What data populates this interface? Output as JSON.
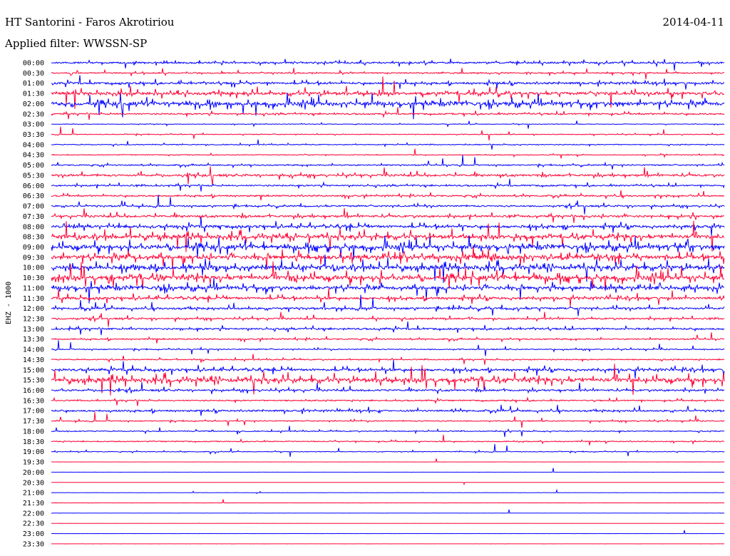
{
  "header": {
    "station": "HT Santorini - Faros Akrotiriou",
    "date": "2014-04-11",
    "filter": "Applied filter: WWSSN-SP"
  },
  "chart_data": {
    "type": "line",
    "ylabel": "EHZ - 1000",
    "colors": {
      "blue": "#0000ff",
      "red": "#ff0033"
    },
    "traces": [
      {
        "label": "00:00",
        "color": "blue",
        "activity": 0.35
      },
      {
        "label": "00:30",
        "color": "red",
        "activity": 0.25
      },
      {
        "label": "01:00",
        "color": "blue",
        "activity": 0.4
      },
      {
        "label": "01:30",
        "color": "red",
        "activity": 0.55
      },
      {
        "label": "02:00",
        "color": "blue",
        "activity": 0.65
      },
      {
        "label": "02:30",
        "color": "red",
        "activity": 0.3
      },
      {
        "label": "03:00",
        "color": "blue",
        "activity": 0.12
      },
      {
        "label": "03:30",
        "color": "red",
        "activity": 0.15
      },
      {
        "label": "04:00",
        "color": "blue",
        "activity": 0.18
      },
      {
        "label": "04:30",
        "color": "red",
        "activity": 0.15
      },
      {
        "label": "05:00",
        "color": "blue",
        "activity": 0.25
      },
      {
        "label": "05:30",
        "color": "red",
        "activity": 0.4
      },
      {
        "label": "06:00",
        "color": "blue",
        "activity": 0.3
      },
      {
        "label": "06:30",
        "color": "red",
        "activity": 0.3
      },
      {
        "label": "07:00",
        "color": "blue",
        "activity": 0.3
      },
      {
        "label": "07:30",
        "color": "red",
        "activity": 0.4
      },
      {
        "label": "08:00",
        "color": "blue",
        "activity": 0.5
      },
      {
        "label": "08:30",
        "color": "red",
        "activity": 0.65
      },
      {
        "label": "09:00",
        "color": "blue",
        "activity": 0.7
      },
      {
        "label": "09:30",
        "color": "red",
        "activity": 0.7
      },
      {
        "label": "10:00",
        "color": "blue",
        "activity": 0.7
      },
      {
        "label": "10:30",
        "color": "red",
        "activity": 0.75
      },
      {
        "label": "11:00",
        "color": "blue",
        "activity": 0.6
      },
      {
        "label": "11:30",
        "color": "red",
        "activity": 0.45
      },
      {
        "label": "12:00",
        "color": "blue",
        "activity": 0.4
      },
      {
        "label": "12:30",
        "color": "red",
        "activity": 0.3
      },
      {
        "label": "13:00",
        "color": "blue",
        "activity": 0.35
      },
      {
        "label": "13:30",
        "color": "red",
        "activity": 0.25
      },
      {
        "label": "14:00",
        "color": "blue",
        "activity": 0.2
      },
      {
        "label": "14:30",
        "color": "red",
        "activity": 0.22
      },
      {
        "label": "15:00",
        "color": "blue",
        "activity": 0.45
      },
      {
        "label": "15:30",
        "color": "red",
        "activity": 0.7
      },
      {
        "label": "16:00",
        "color": "blue",
        "activity": 0.35
      },
      {
        "label": "16:30",
        "color": "red",
        "activity": 0.25
      },
      {
        "label": "17:00",
        "color": "blue",
        "activity": 0.35
      },
      {
        "label": "17:30",
        "color": "red",
        "activity": 0.2
      },
      {
        "label": "18:00",
        "color": "blue",
        "activity": 0.2
      },
      {
        "label": "18:30",
        "color": "red",
        "activity": 0.2
      },
      {
        "label": "19:00",
        "color": "blue",
        "activity": 0.15
      },
      {
        "label": "19:30",
        "color": "red",
        "activity": 0.02
      },
      {
        "label": "20:00",
        "color": "blue",
        "activity": 0.02
      },
      {
        "label": "20:30",
        "color": "red",
        "activity": 0.03
      },
      {
        "label": "21:00",
        "color": "blue",
        "activity": 0.03
      },
      {
        "label": "21:30",
        "color": "red",
        "activity": 0.03
      },
      {
        "label": "22:00",
        "color": "blue",
        "activity": 0.03
      },
      {
        "label": "22:30",
        "color": "red",
        "activity": 0.02
      },
      {
        "label": "23:00",
        "color": "blue",
        "activity": 0.02
      },
      {
        "label": "23:30",
        "color": "red",
        "activity": 0.02
      }
    ]
  }
}
